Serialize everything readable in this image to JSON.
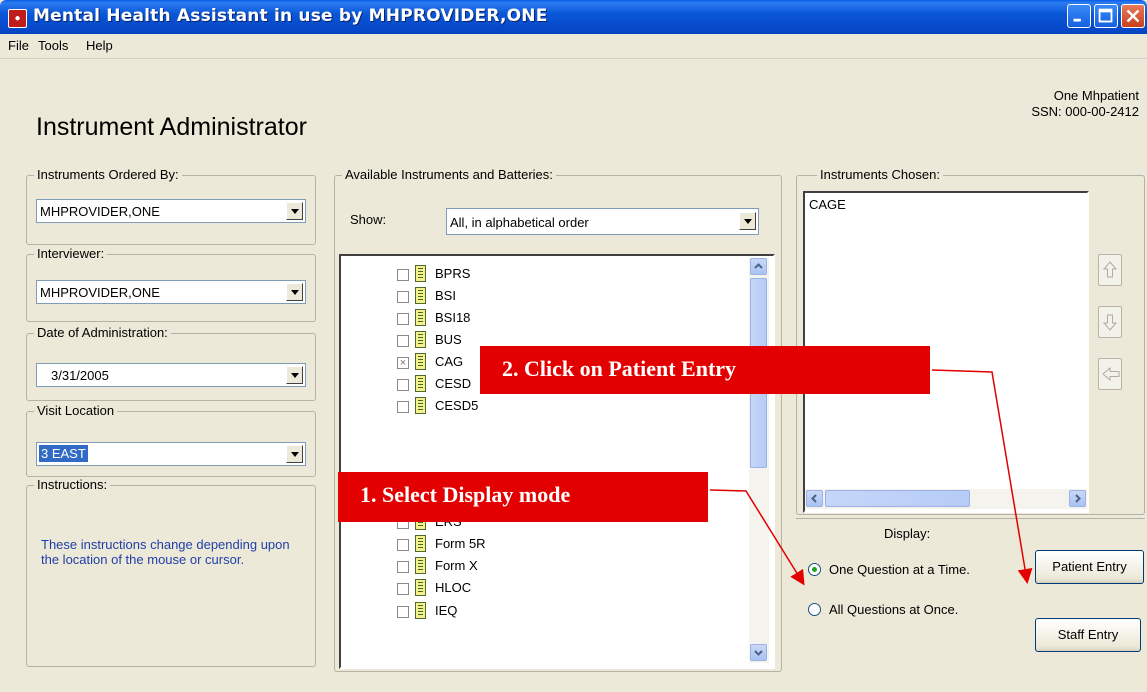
{
  "window": {
    "title": "Mental Health Assistant in use by MHPROVIDER,ONE",
    "app_icon_text": "●"
  },
  "menu": {
    "file": "File",
    "tools": "Tools",
    "help": "Help"
  },
  "header": {
    "title": "Instrument Administrator",
    "patient_name": "One Mhpatient",
    "patient_ssn": "SSN: 000-00-2412"
  },
  "left": {
    "ordered_by": {
      "label": "Instruments Ordered By:",
      "value": "MHPROVIDER,ONE"
    },
    "interviewer": {
      "label": "Interviewer:",
      "value": "MHPROVIDER,ONE"
    },
    "date": {
      "label": "Date of Administration:",
      "value": "3/31/2005"
    },
    "location": {
      "label": "Visit Location",
      "value": "3 EAST"
    },
    "instructions": {
      "label": "Instructions:",
      "text": "These instructions change depending upon the location of the mouse or cursor."
    }
  },
  "available": {
    "label": "Available Instruments and Batteries:",
    "show_label": "Show:",
    "show_value": "All, in alphabetical order",
    "items": [
      {
        "label": "BPRS",
        "checked": false
      },
      {
        "label": "BSI",
        "checked": false
      },
      {
        "label": "BSI18",
        "checked": false
      },
      {
        "label": "BUS",
        "checked": false
      },
      {
        "label": "CAG",
        "checked": true
      },
      {
        "label": "CESD",
        "checked": false
      },
      {
        "label": "CESD5",
        "checked": false
      },
      {
        "label": "ERS",
        "checked": false
      },
      {
        "label": "Form 5R",
        "checked": false
      },
      {
        "label": "Form X",
        "checked": false
      },
      {
        "label": "HLOC",
        "checked": false
      },
      {
        "label": "IEQ",
        "checked": false
      }
    ]
  },
  "chosen": {
    "label": "Instruments Chosen:",
    "items": [
      "CAGE"
    ]
  },
  "display": {
    "label": "Display:",
    "one_at_a_time": "One Question at a Time.",
    "all_at_once": "All Questions at Once.",
    "selected": "one_at_a_time"
  },
  "buttons": {
    "patient_entry": "Patient Entry",
    "staff_entry": "Staff Entry"
  },
  "callouts": {
    "step1": "1. Select Display mode",
    "step2": "2. Click on Patient Entry"
  },
  "colors": {
    "callout_red": "#e30000",
    "instructions_blue": "#1f3fa8",
    "selection_blue": "#316ac5"
  }
}
